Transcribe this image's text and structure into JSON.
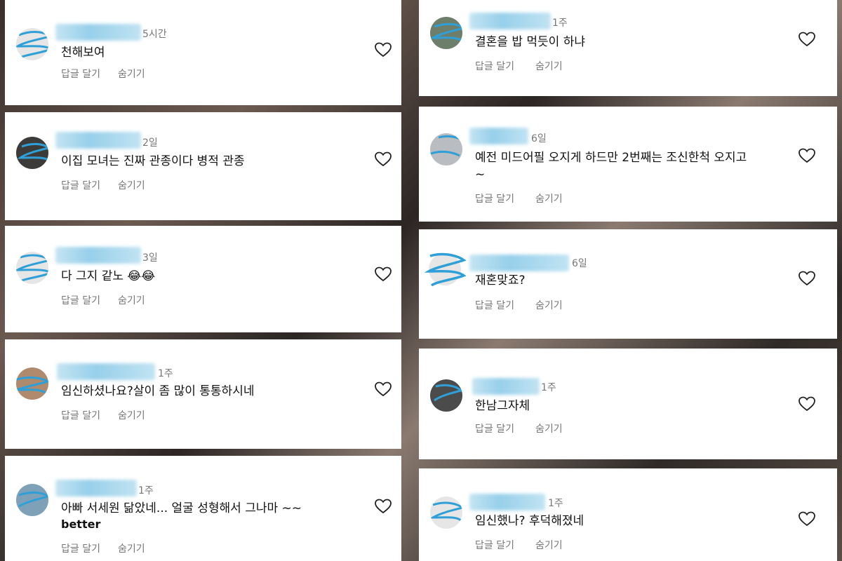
{
  "actions": {
    "reply_label": "답글 달기",
    "hide_label": "숨기기"
  },
  "icons": {
    "like": "heart-outline-icon",
    "emoji": "laughing-face-emoji"
  },
  "left_column": [
    {
      "time": "5시간",
      "text": "천해보여"
    },
    {
      "time": "2일",
      "text": "이집 모녀는 진짜 관종이다 병적 관종"
    },
    {
      "time": "3일",
      "text": "다 그지 같노 😂😂"
    },
    {
      "time": "1주",
      "text": "임신하셨나요?살이 좀 많이 통통하시네"
    },
    {
      "time": "1주",
      "text": "아빠 서세원  닮았네... 얼굴 성형해서 그나마 ~~",
      "text2": "better"
    }
  ],
  "right_column": [
    {
      "time": "1주",
      "text": "결혼을 밥 먹듯이 하냐"
    },
    {
      "time": "6일",
      "text": "예전 미드어필 오지게 하드만 2번째는 조신한척 오지고",
      "text2": "~"
    },
    {
      "time": "6일",
      "text": "재혼맞죠?"
    },
    {
      "time": "1주",
      "text": "한남그자체"
    },
    {
      "time": "1주",
      "text": "임신했나? 후덕해졌네"
    }
  ],
  "colors": {
    "card_bg": "#ffffff",
    "text": "#111111",
    "meta": "#777777",
    "censor_blue": "#2f9fd8"
  }
}
